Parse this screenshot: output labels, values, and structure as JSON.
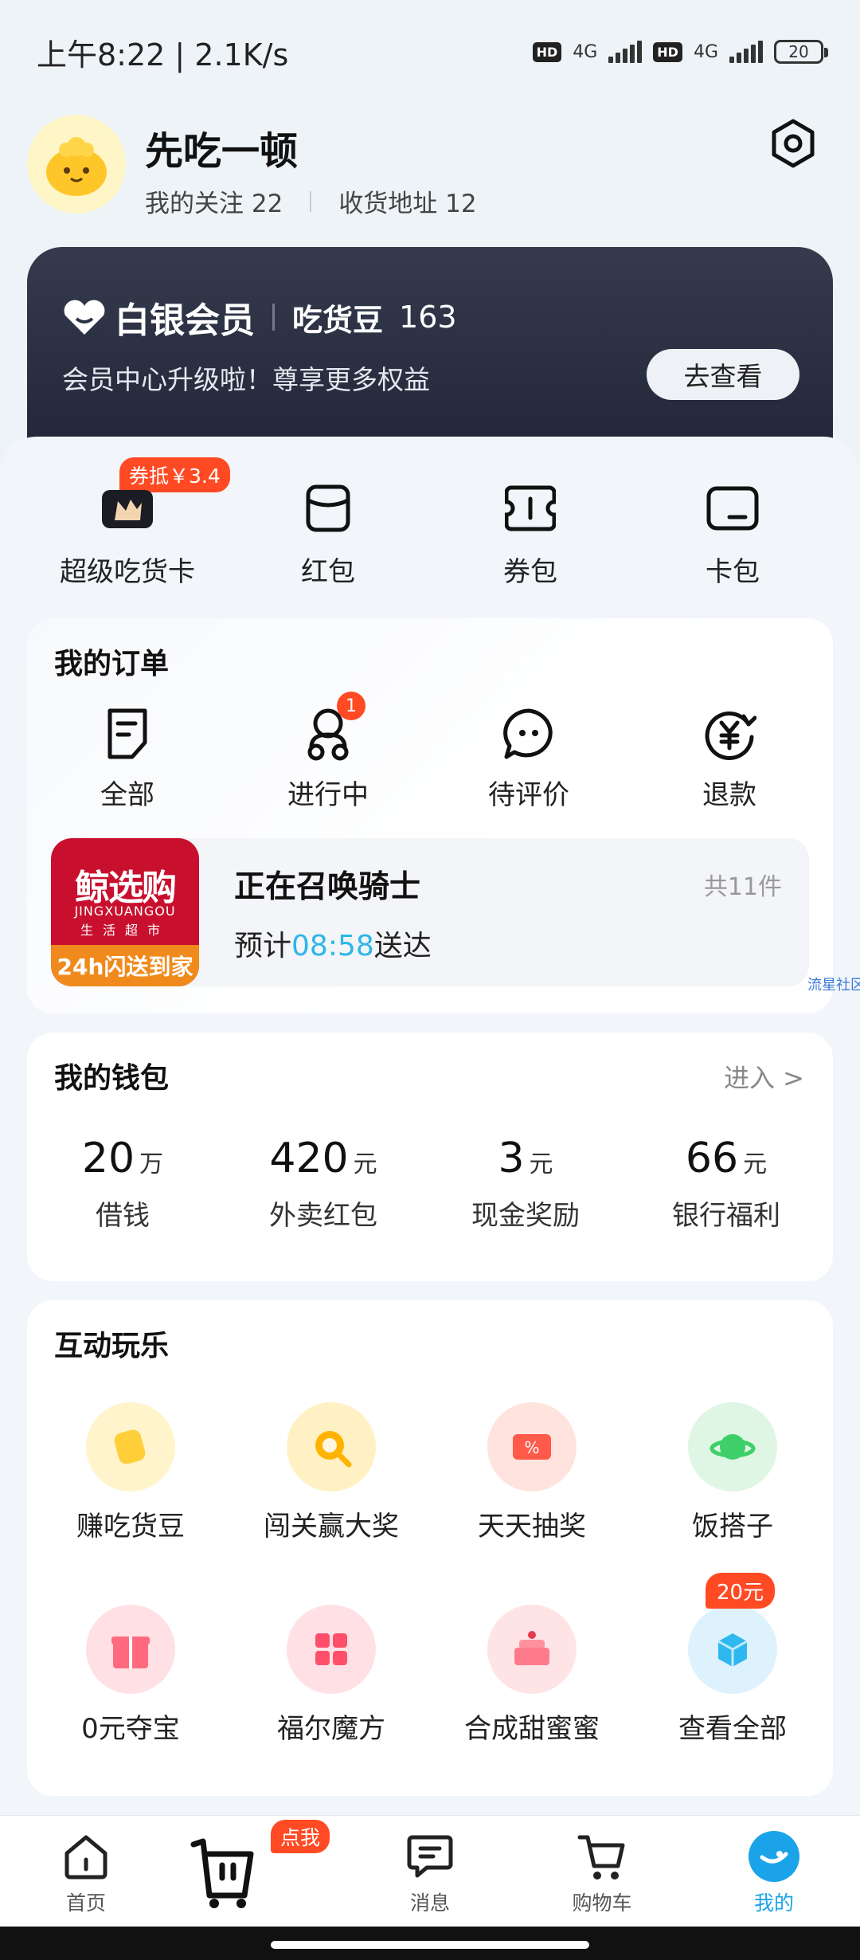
{
  "status_bar": {
    "time_speed": "上午8:22 | 2.1K/s",
    "hd1": "HD",
    "net1": "4G",
    "hd2": "HD",
    "net2": "4G",
    "battery": "20"
  },
  "header": {
    "username": "先吃一顿",
    "follow": "我的关注 22",
    "address": "收货地址 12"
  },
  "member": {
    "title": "白银会员",
    "bean_label": "吃货豆",
    "bean_value": "163",
    "subtitle": "会员中心升级啦！尊享更多权益",
    "button": "去查看"
  },
  "quick": {
    "coupon_tag": "券抵￥3.4",
    "items": [
      {
        "label": "超级吃货卡",
        "icon": "super-card-icon"
      },
      {
        "label": "红包",
        "icon": "red-packet-icon"
      },
      {
        "label": "券包",
        "icon": "coupon-icon"
      },
      {
        "label": "卡包",
        "icon": "card-icon"
      }
    ]
  },
  "orders": {
    "title": "我的订单",
    "items": [
      {
        "label": "全部",
        "icon": "document-icon"
      },
      {
        "label": "进行中",
        "icon": "delivery-icon",
        "badge": "1"
      },
      {
        "label": "待评价",
        "icon": "chat-icon"
      },
      {
        "label": "退款",
        "icon": "refund-icon"
      }
    ],
    "shop": {
      "name": "鲸选购",
      "en": "JINGXUANGOU",
      "cn_sub": "生活超市",
      "slogan": "24h闪送到家"
    },
    "status_title": "正在召唤骑士",
    "count": "共11件",
    "eta_prefix": "预计",
    "eta_time": "08:58",
    "eta_suffix": "送达",
    "side_tag": "流星社区"
  },
  "wallet": {
    "title": "我的钱包",
    "enter": "进入 >",
    "items": [
      {
        "value": "20",
        "unit": "万",
        "label": "借钱"
      },
      {
        "value": "420",
        "unit": "元",
        "label": "外卖红包"
      },
      {
        "value": "3",
        "unit": "元",
        "label": "现金奖励"
      },
      {
        "value": "66",
        "unit": "元",
        "label": "银行福利"
      }
    ]
  },
  "play": {
    "title": "互动玩乐",
    "badge": "20元",
    "items": [
      {
        "label": "赚吃货豆",
        "icon": "bean-icon",
        "color": "#ffcf3a",
        "bg": "#fff4cc"
      },
      {
        "label": "闯关赢大奖",
        "icon": "magnifier-icon",
        "color": "#ffb300",
        "bg": "#fff1c4"
      },
      {
        "label": "天天抽奖",
        "icon": "ticket-icon",
        "color": "#ff5a4a",
        "bg": "#ffe3df"
      },
      {
        "label": "饭搭子",
        "icon": "planet-icon",
        "color": "#3fcf6a",
        "bg": "#dff6e4"
      },
      {
        "label": "0元夺宝",
        "icon": "gift-icon",
        "color": "#ff6a7e",
        "bg": "#ffe1e5"
      },
      {
        "label": "福尔魔方",
        "icon": "cube-icon",
        "color": "#ff4f6a",
        "bg": "#ffe1e5"
      },
      {
        "label": "合成甜蜜蜜",
        "icon": "cake-icon",
        "color": "#ff7b8c",
        "bg": "#ffe4e6"
      },
      {
        "label": "查看全部",
        "icon": "box-icon",
        "color": "#2fb7f0",
        "bg": "#ddf2fc"
      }
    ]
  },
  "tabbar": {
    "dianwo": "点我",
    "items": [
      {
        "label": "首页",
        "icon": "home-icon"
      },
      {
        "label": "",
        "icon": "basket-icon"
      },
      {
        "label": "消息",
        "icon": "message-icon"
      },
      {
        "label": "购物车",
        "icon": "cart-icon"
      },
      {
        "label": "我的",
        "icon": "profile-icon"
      }
    ]
  }
}
